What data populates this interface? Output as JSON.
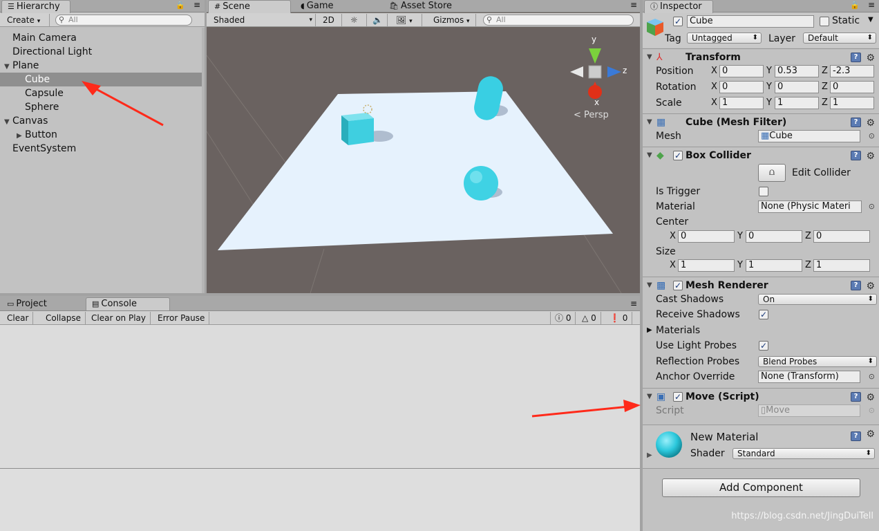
{
  "hierarchy": {
    "tab": "Hierarchy",
    "create": "Create",
    "search_placeholder": "All",
    "items": [
      {
        "label": "Main Camera",
        "indent": 0,
        "arrow": ""
      },
      {
        "label": "Directional Light",
        "indent": 0,
        "arrow": ""
      },
      {
        "label": "Plane",
        "indent": 0,
        "arrow": "▼"
      },
      {
        "label": "Cube",
        "indent": 1,
        "arrow": "",
        "selected": true
      },
      {
        "label": "Capsule",
        "indent": 1,
        "arrow": ""
      },
      {
        "label": "Sphere",
        "indent": 1,
        "arrow": ""
      },
      {
        "label": "Canvas",
        "indent": 0,
        "arrow": "▼"
      },
      {
        "label": "Button",
        "indent": 1,
        "arrow": "▶"
      },
      {
        "label": "EventSystem",
        "indent": 0,
        "arrow": ""
      }
    ]
  },
  "scene": {
    "tabs": [
      "Scene",
      "Game",
      "Asset Store"
    ],
    "shading": "Shaded",
    "mode_2d": "2D",
    "gizmos": "Gizmos",
    "search_placeholder": "All",
    "persp": "Persp",
    "axis_y": "y",
    "axis_z": "z",
    "axis_x": "x"
  },
  "console": {
    "tabs": [
      "Project",
      "Console"
    ],
    "buttons": [
      "Clear",
      "Collapse",
      "Clear on Play",
      "Error Pause"
    ],
    "counts": [
      "0",
      "0",
      "0"
    ]
  },
  "inspector": {
    "tab": "Inspector",
    "name": "Cube",
    "static_label": "Static",
    "tag_label": "Tag",
    "tag_value": "Untagged",
    "layer_label": "Layer",
    "layer_value": "Default",
    "transform": {
      "title": "Transform",
      "rows": [
        {
          "label": "Position",
          "x": "0",
          "y": "0.53",
          "z": "-2.3"
        },
        {
          "label": "Rotation",
          "x": "0",
          "y": "0",
          "z": "0"
        },
        {
          "label": "Scale",
          "x": "1",
          "y": "1",
          "z": "1"
        }
      ]
    },
    "mesh_filter": {
      "title": "Cube (Mesh Filter)",
      "mesh_label": "Mesh",
      "mesh_value": "Cube"
    },
    "box_collider": {
      "title": "Box Collider",
      "edit_label": "Edit Collider",
      "trigger_label": "Is Trigger",
      "material_label": "Material",
      "material_value": "None (Physic Materi",
      "center_label": "Center",
      "center": {
        "x": "0",
        "y": "0",
        "z": "0"
      },
      "size_label": "Size",
      "size": {
        "x": "1",
        "y": "1",
        "z": "1"
      }
    },
    "mesh_renderer": {
      "title": "Mesh Renderer",
      "cast_label": "Cast Shadows",
      "cast_value": "On",
      "receive_label": "Receive Shadows",
      "materials_label": "Materials",
      "light_probes_label": "Use Light Probes",
      "reflection_label": "Reflection Probes",
      "reflection_value": "Blend Probes",
      "anchor_label": "Anchor Override",
      "anchor_value": "None (Transform)"
    },
    "move_script": {
      "title": "Move (Script)",
      "script_label": "Script",
      "script_value": "Move"
    },
    "material": {
      "name": "New Material",
      "shader_label": "Shader",
      "shader_value": "Standard"
    },
    "add_component": "Add Component"
  },
  "watermark": "https://blog.csdn.net/JingDuiTell",
  "colors": {
    "selection": "#8f8f8f",
    "panel": "#c2c2c2",
    "scene_bg": "#6a6260",
    "plane": "#e8f4ff",
    "object": "#3fd2e4",
    "arrow": "#ff2a1a"
  }
}
